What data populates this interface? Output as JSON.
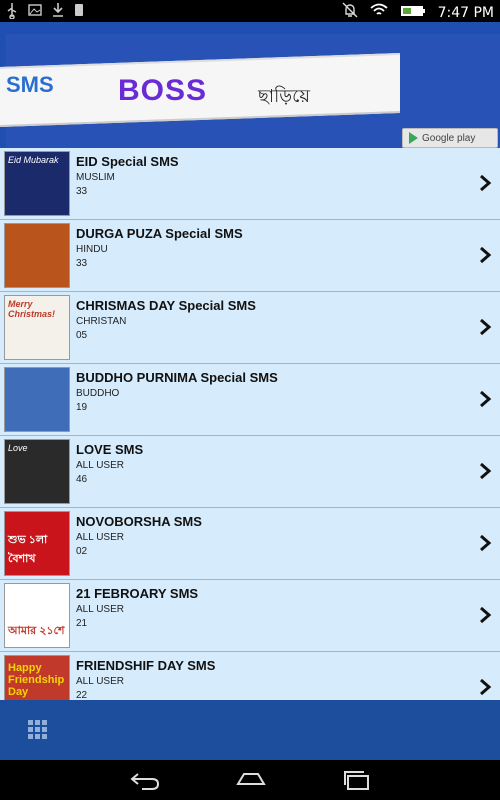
{
  "status_bar": {
    "time": "7:47 PM",
    "left_icons": [
      "usb-icon",
      "image-icon",
      "download-icon",
      "phone-icon"
    ],
    "right_icons": [
      "alarm-off-icon",
      "wifi-icon",
      "battery-icon"
    ]
  },
  "banner": {
    "logo_text": "SMS",
    "title": "BOSS",
    "subtitle": "ছাড়িয়ে",
    "store_badge": "Google play"
  },
  "list": {
    "items": [
      {
        "title": "EID Special SMS",
        "category": "MUSLIM",
        "count": "33",
        "thumb_caption": "Eid Mubarak",
        "thumb_bg": "#1b2a6b"
      },
      {
        "title": "DURGA PUZA Special SMS",
        "category": "HINDU",
        "count": "33",
        "thumb_caption": "",
        "thumb_bg": "#b8541c"
      },
      {
        "title": "CHRISMAS DAY Special SMS",
        "category": "CHRISTAN",
        "count": "05",
        "thumb_caption": "Merry Christmas!",
        "thumb_bg": "#f4f1ea"
      },
      {
        "title": "BUDDHO PURNIMA Special SMS",
        "category": "BUDDHO",
        "count": "19",
        "thumb_caption": "",
        "thumb_bg": "#3f6db8"
      },
      {
        "title": "LOVE SMS",
        "category": "ALL USER",
        "count": "46",
        "thumb_caption": "Love",
        "thumb_bg": "#2a2a2a"
      },
      {
        "title": "NOVOBORSHA SMS",
        "category": "ALL USER",
        "count": "02",
        "thumb_caption": "শুভ ১লা বৈশাখ",
        "thumb_bg": "#c8141a"
      },
      {
        "title": "21 FEBROARY SMS",
        "category": "ALL USER",
        "count": "21",
        "thumb_caption": "আমার ২১শে",
        "thumb_bg": "#ffffff"
      },
      {
        "title": "FRIENDSHIF DAY SMS",
        "category": "ALL USER",
        "count": "22",
        "thumb_caption": "Happy Friendship Day",
        "thumb_bg": "#c0392b"
      }
    ]
  },
  "bottom_bar": {
    "menu_icon": "grid-menu-icon"
  },
  "nav_bar": {
    "buttons": [
      "back-icon",
      "home-icon",
      "recents-icon"
    ]
  },
  "colors": {
    "banner": "#1f4fb0",
    "list_bg": "#d6ebfb",
    "bottom_bar": "#1d4e9e",
    "divider": "#9eb7cc"
  }
}
